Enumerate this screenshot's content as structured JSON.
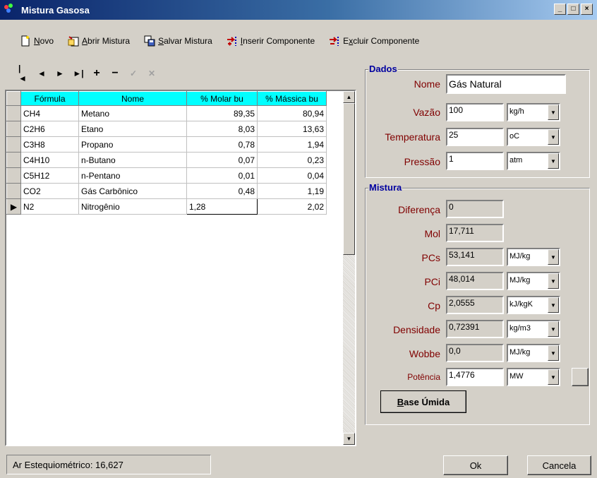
{
  "window": {
    "title": "Mistura Gasosa",
    "min": "_",
    "max": "□",
    "close": "×"
  },
  "toolbar": {
    "novo": {
      "u": "N",
      "rest": "ovo"
    },
    "abrir": {
      "u": "A",
      "rest": "brir Mistura"
    },
    "salvar": {
      "u": "S",
      "rest": "alvar Mistura"
    },
    "inserir": {
      "u": "I",
      "rest": "nserir Componente"
    },
    "excluir": {
      "pre": "E",
      "u": "x",
      "rest": "cluir Componente"
    }
  },
  "navigator": {
    "first": "|◄",
    "prior": "◄",
    "next": "►",
    "last": "►|",
    "insert": "+",
    "delete": "−",
    "post": "✓",
    "cancel": "✕"
  },
  "grid": {
    "headers": [
      "Fórmula",
      "Nome",
      "% Molar bu",
      "% Mássica bu"
    ],
    "rows": [
      [
        "CH4",
        "Metano",
        "89,35",
        "80,94"
      ],
      [
        "C2H6",
        "Etano",
        "8,03",
        "13,63"
      ],
      [
        "C3H8",
        "Propano",
        "0,78",
        "1,94"
      ],
      [
        "C4H10",
        "n-Butano",
        "0,07",
        "0,23"
      ],
      [
        "C5H12",
        "n-Pentano",
        "0,01",
        "0,04"
      ],
      [
        "CO2",
        "Gás Carbônico",
        "0,48",
        "1,19"
      ],
      [
        "N2",
        "Nitrogênio",
        "1,28",
        "2,02"
      ]
    ],
    "current_row_indicator": "▶"
  },
  "dados": {
    "title": "Dados",
    "nome": {
      "label": "Nome",
      "value": "Gás Natural"
    },
    "vazao": {
      "label": "Vazão",
      "value": "100",
      "unit": "kg/h"
    },
    "temperatura": {
      "label": "Temperatura",
      "value": "25",
      "unit": "oC"
    },
    "pressao": {
      "label": "Pressão",
      "value": "1",
      "unit": "atm"
    }
  },
  "mistura": {
    "title": "Mistura",
    "diferenca": {
      "label": "Diferença",
      "value": "0"
    },
    "mol": {
      "label": "Mol",
      "value": "17,711"
    },
    "pcs": {
      "label": "PCs",
      "value": "53,141",
      "unit": "MJ/kg"
    },
    "pci": {
      "label": "PCi",
      "value": "48,014",
      "unit": "MJ/kg"
    },
    "cp": {
      "label": "Cp",
      "value": "2,0555",
      "unit": "kJ/kgK"
    },
    "densidade": {
      "label": "Densidade",
      "value": "0,72391",
      "unit": "kg/m3"
    },
    "wobbe": {
      "label": "Wobbe",
      "value": "0,0",
      "unit": "MJ/kg"
    },
    "potencia": {
      "label": "Potência",
      "value": "1,4776",
      "unit": "MW"
    },
    "base_umida": {
      "u": "B",
      "rest": "ase Úmida"
    }
  },
  "status": {
    "ar_esteq": "Ar Estequiométrico: 16,627"
  },
  "buttons": {
    "ok": "Ok",
    "cancela": "Cancela"
  },
  "colors": {
    "grid_header": "#00ffff",
    "label": "#800000",
    "group_title": "#0000a0"
  }
}
